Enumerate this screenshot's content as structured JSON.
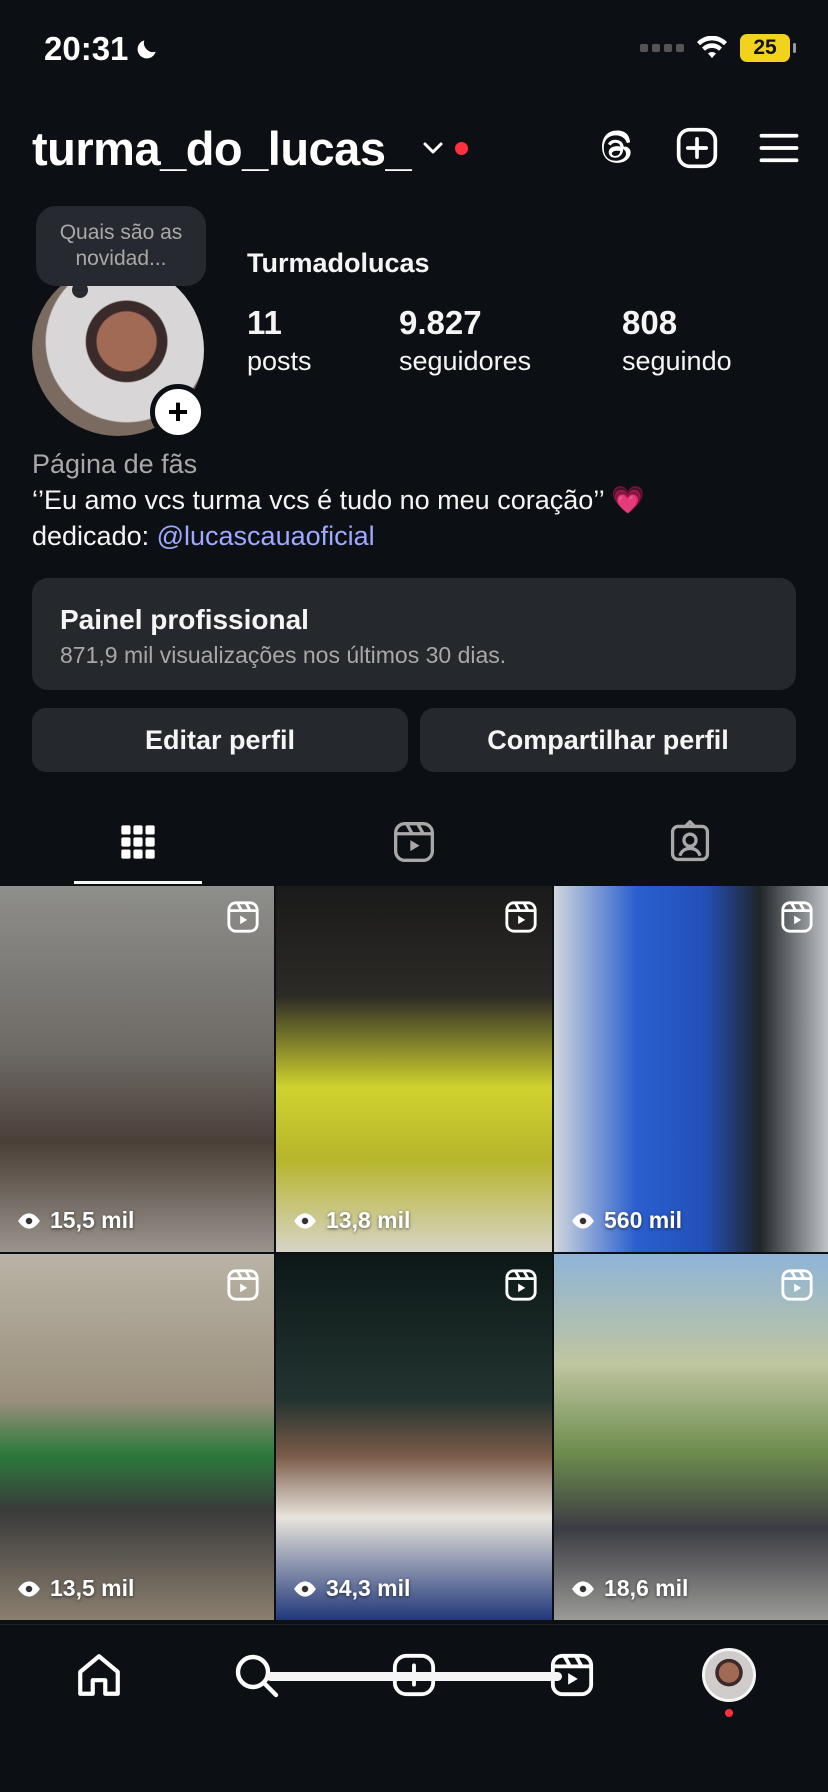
{
  "status_bar": {
    "time": "20:31",
    "battery": "25",
    "moon_icon": "moon-icon",
    "wifi_icon": "wifi-icon"
  },
  "header": {
    "username": "turma_do_lucas_",
    "chevron_icon": "chevron-down-icon",
    "notification_color": "#ff3040",
    "actions": [
      "threads-icon",
      "create-icon",
      "menu-icon"
    ]
  },
  "profile": {
    "note": "Quais são as novidad...",
    "display_name": "Turmadolucas",
    "stats": [
      {
        "value": "11",
        "label": "posts"
      },
      {
        "value": "9.827",
        "label": "seguidores"
      },
      {
        "value": "808",
        "label": "seguindo"
      }
    ],
    "bio_category": "Página de fãs",
    "bio_line": "‘’Eu amo vcs turma vcs é tudo no meu coração’’ 💗",
    "bio_dedicated_prefix": "dedicado: ",
    "bio_mention": "@lucascauaoficial"
  },
  "pro_panel": {
    "title": "Painel profissional",
    "subtitle": "871,9 mil visualizações nos últimos 30 dias."
  },
  "buttons": {
    "edit": "Editar perfil",
    "share": "Compartilhar perfil"
  },
  "tabs": [
    "grid-icon",
    "reels-icon",
    "tagged-icon"
  ],
  "grid": [
    {
      "views": "15,5 mil"
    },
    {
      "views": "13,8 mil"
    },
    {
      "views": "560 mil"
    },
    {
      "views": "13,5 mil"
    },
    {
      "views": "34,3 mil"
    },
    {
      "views": "18,6 mil"
    }
  ],
  "bottom_nav": [
    "home-icon",
    "search-icon",
    "create-icon",
    "reels-icon",
    "profile-avatar"
  ],
  "colors": {
    "background": "#0c1014",
    "surface": "#25292e",
    "mention": "#a0a8ff",
    "badge": "#ff3040"
  }
}
